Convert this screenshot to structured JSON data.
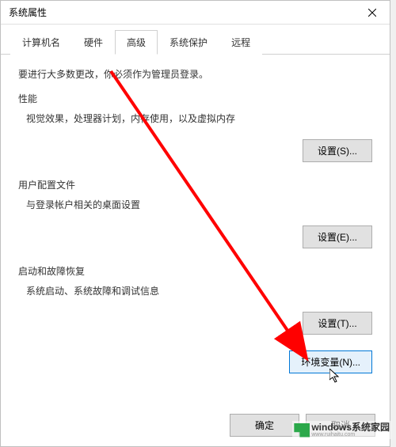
{
  "window": {
    "title": "系统属性"
  },
  "tabs": {
    "computer_name": "计算机名",
    "hardware": "硬件",
    "advanced": "高级",
    "system_protection": "系统保护",
    "remote": "远程"
  },
  "content": {
    "notice": "要进行大多数更改，你必须作为管理员登录。",
    "performance": {
      "title": "性能",
      "desc": "视觉效果，处理器计划，内存使用，以及虚拟内存",
      "button": "设置(S)..."
    },
    "user_profiles": {
      "title": "用户配置文件",
      "desc": "与登录帐户相关的桌面设置",
      "button": "设置(E)..."
    },
    "startup": {
      "title": "启动和故障恢复",
      "desc": "系统启动、系统故障和调试信息",
      "button": "设置(T)..."
    },
    "env_vars": {
      "button": "环境变量(N)..."
    }
  },
  "bottom": {
    "ok": "确定",
    "cancel": "取消"
  },
  "watermark": {
    "main": "windows系统家园",
    "sub": "www.ruihaitu.com"
  }
}
